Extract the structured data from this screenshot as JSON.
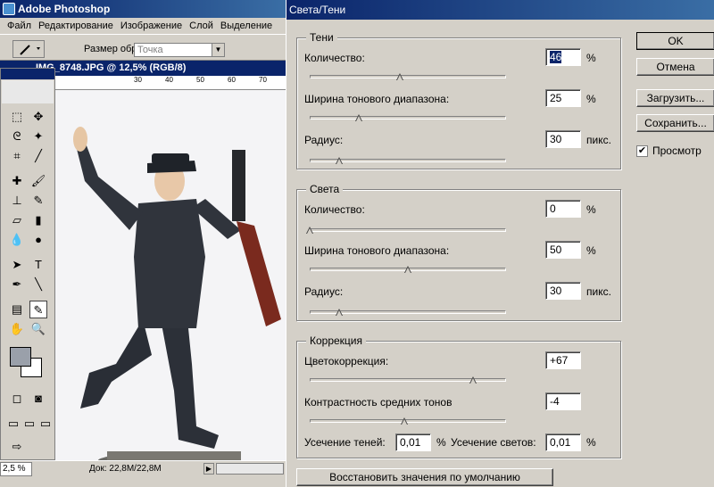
{
  "photoshop": {
    "title": "Adobe Photoshop",
    "menu": [
      "Файл",
      "Редактирование",
      "Изображение",
      "Слой",
      "Выделение"
    ],
    "options": {
      "sample_size_label": "Размер образца:",
      "sample_size_value": "Точка"
    },
    "document": {
      "title": "IMG_8748.JPG @ 12,5% (RGB/8)",
      "ruler_ticks": [
        "30",
        "40",
        "50",
        "60",
        "70"
      ]
    },
    "status": {
      "zoom": "2,5 %",
      "doc_size": "Док: 22,8M/22,8M"
    }
  },
  "dialog": {
    "title": "Света/Тени",
    "shadows": {
      "group_title": "Тени",
      "amount_label": "Количество:",
      "amount_value": "46",
      "amount_unit": "%",
      "amount_fraction": 0.46,
      "tonal_width_label": "Ширина тонового диапазона:",
      "tonal_width_value": "25",
      "tonal_width_unit": "%",
      "tonal_width_fraction": 0.25,
      "radius_label": "Радиус:",
      "radius_value": "30",
      "radius_unit": "пикс.",
      "radius_fraction": 0.15
    },
    "highlights": {
      "group_title": "Света",
      "amount_label": "Количество:",
      "amount_value": "0",
      "amount_unit": "%",
      "amount_fraction": 0.0,
      "tonal_width_label": "Ширина тонового диапазона:",
      "tonal_width_value": "50",
      "tonal_width_unit": "%",
      "tonal_width_fraction": 0.5,
      "radius_label": "Радиус:",
      "radius_value": "30",
      "radius_unit": "пикс.",
      "radius_fraction": 0.15
    },
    "adjustments": {
      "group_title": "Коррекция",
      "color_correction_label": "Цветокоррекция:",
      "color_correction_value": "+67",
      "color_correction_fraction": 0.83,
      "midtone_contrast_label": "Контрастность средних тонов",
      "midtone_contrast_value": "-4",
      "midtone_contrast_fraction": 0.48,
      "black_clip_label": "Усечение теней:",
      "black_clip_value": "0,01",
      "black_clip_unit": "%",
      "white_clip_label": "Усечение светов:",
      "white_clip_value": "0,01",
      "white_clip_unit": "%"
    },
    "buttons": {
      "ok": "OK",
      "cancel": "Отмена",
      "load": "Загрузить...",
      "save": "Сохранить...",
      "preview": "Просмотр",
      "restore_defaults": "Восстановить значения по умолчанию"
    },
    "preview_checked": true
  },
  "colors": {
    "title_bar": "#0a246a",
    "dialog_bg": "#d4d0c8",
    "foreground_swatch": "#9aa0aa",
    "background_swatch": "#ffffff"
  }
}
